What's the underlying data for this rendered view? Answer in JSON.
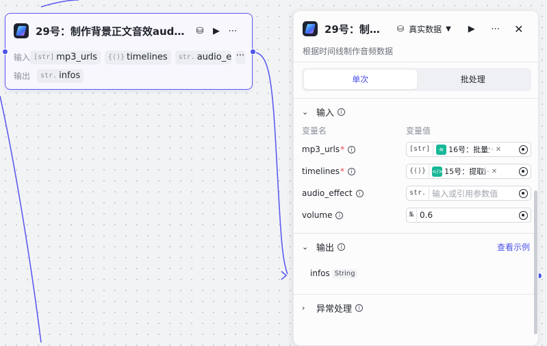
{
  "node": {
    "title": "29号：制作背景正文音效aud…",
    "input_label": "输入",
    "output_label": "输出",
    "inputs": [
      {
        "type": "[str]",
        "name": "mp3_urls"
      },
      {
        "type": "{⟨⟩}",
        "name": "timelines"
      },
      {
        "type": "str.",
        "name": "audio_effec"
      }
    ],
    "more": "···",
    "outputs": [
      {
        "type": "str.",
        "name": "infos"
      }
    ]
  },
  "panel": {
    "title": "29号：制…",
    "data_mode": "真实数据",
    "description": "根据时间线制作音频数据",
    "tabs": [
      {
        "label": "单次",
        "active": true
      },
      {
        "label": "批处理",
        "active": false
      }
    ],
    "input_section": "输入",
    "col_name": "变量名",
    "col_value": "变量值",
    "variables": [
      {
        "name": "mp3_urls",
        "required": true,
        "type": "[str]",
        "ref_icon": "layers-icon",
        "ref": "16号：批量生…"
      },
      {
        "name": "timelines",
        "required": true,
        "type": "{⟨⟩}",
        "ref_icon": "code-icon",
        "ref": "15号：提取配…"
      },
      {
        "name": "audio_effect",
        "required": false,
        "type": "str.",
        "placeholder": "输入或引用参数值"
      },
      {
        "name": "volume",
        "required": false,
        "type": "№",
        "value": "0.6"
      }
    ],
    "output_section": "输出",
    "output_example_link": "查看示例",
    "outputs": [
      {
        "name": "infos",
        "type": "String"
      }
    ],
    "error_section": "异常处理"
  },
  "colors": {
    "accent": "#4d53e8",
    "ref_icon": "#18b898",
    "required": "#e44444"
  }
}
